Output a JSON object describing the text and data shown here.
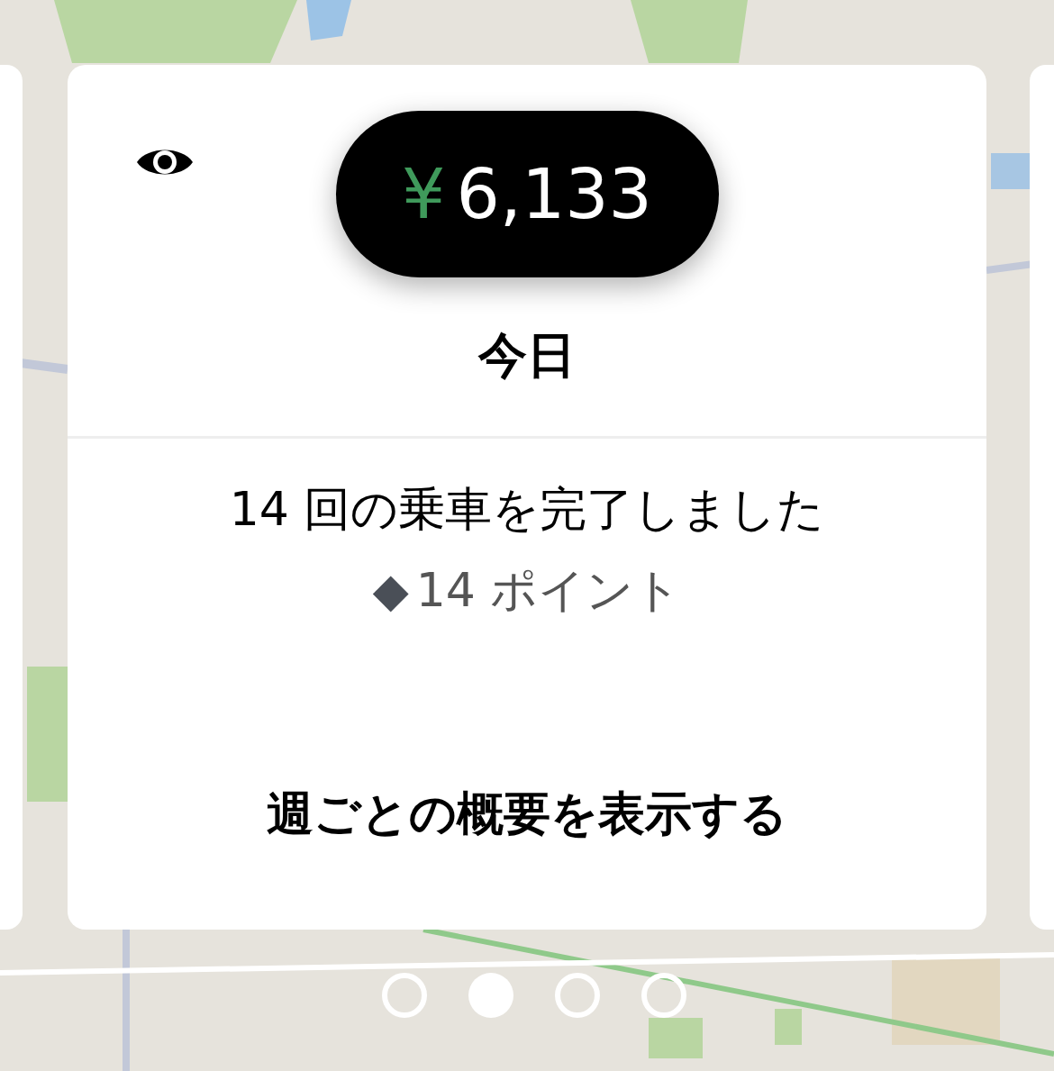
{
  "balance": {
    "currency": "¥",
    "amount": "6,133"
  },
  "period": "今日",
  "summary": "14 回の乗車を完了しました",
  "points": {
    "icon": "◆",
    "text": "14 ポイント"
  },
  "link": "週ごとの概要を表示する",
  "pages": [
    {
      "selected": false
    },
    {
      "selected": true
    },
    {
      "selected": false
    },
    {
      "selected": false
    }
  ]
}
